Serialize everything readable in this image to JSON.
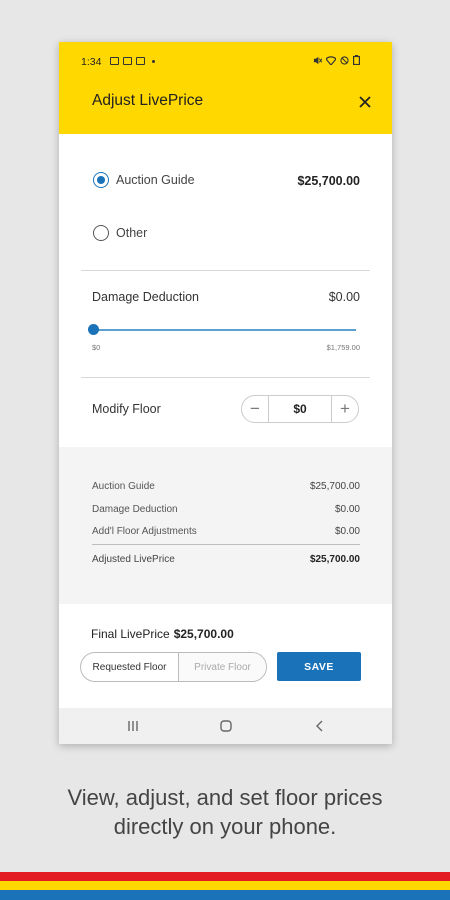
{
  "status_bar": {
    "time": "1:34"
  },
  "header": {
    "title": "Adjust LivePrice"
  },
  "price_options": [
    {
      "label": "Auction Guide",
      "value": "$25,700.00",
      "selected": true
    },
    {
      "label": "Other",
      "value": "",
      "selected": false
    }
  ],
  "damage_deduction": {
    "label": "Damage Deduction",
    "value": "$0.00",
    "slider_min": "$0",
    "slider_max": "$1,759.00",
    "slider_fraction": 0
  },
  "modify_floor": {
    "label": "Modify Floor",
    "value": "$0",
    "decrement": "−",
    "increment": "+"
  },
  "summary": {
    "rows": [
      {
        "label": "Auction Guide",
        "value": "$25,700.00"
      },
      {
        "label": "Damage Deduction",
        "value": "$0.00"
      },
      {
        "label": "Add'l Floor Adjustments",
        "value": "$0.00"
      }
    ],
    "total_label": "Adjusted LivePrice",
    "total_value": "$25,700.00"
  },
  "final": {
    "label": "Final LivePrice",
    "value": "$25,700.00"
  },
  "floor_toggle": {
    "active": "Requested Floor",
    "inactive": "Private Floor"
  },
  "save_label": "SAVE",
  "caption": {
    "line1": "View, adjust, and set floor prices",
    "line2": "directly on your phone."
  },
  "colors": {
    "header": "#ffd800",
    "accent": "#1a73b8",
    "stripe_red": "#e31b23",
    "stripe_yellow": "#ffd800",
    "stripe_blue": "#1a73b8"
  }
}
